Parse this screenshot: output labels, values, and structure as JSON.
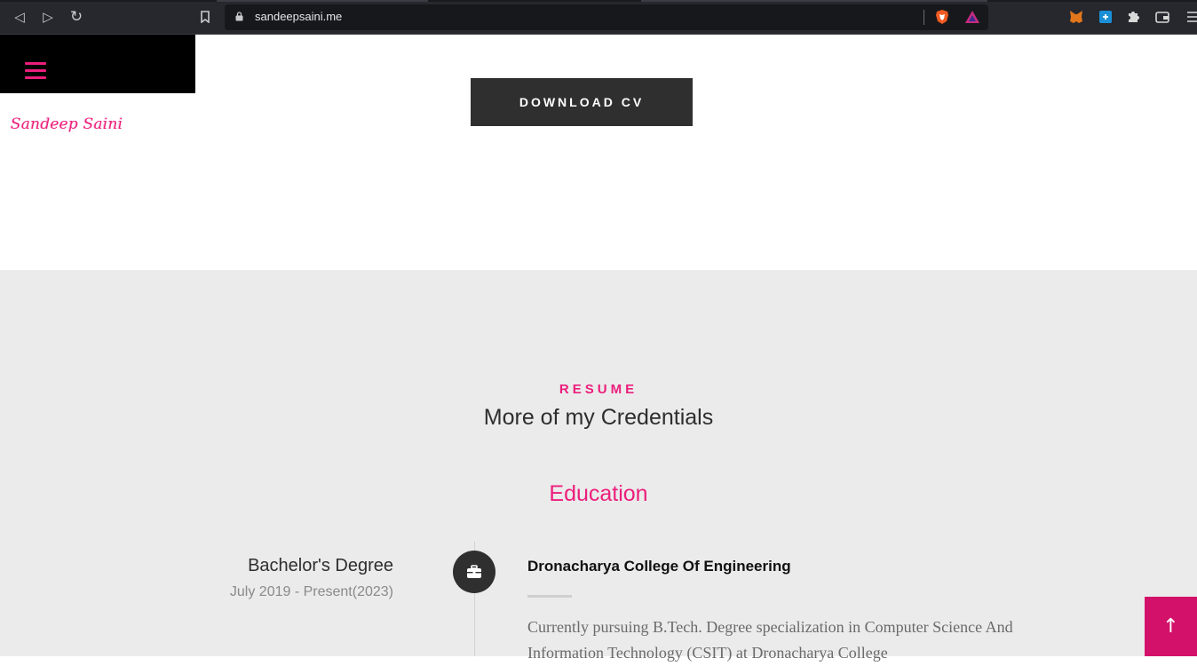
{
  "browser": {
    "url": "sandeepsaini.me",
    "nav": {
      "back": "◁",
      "forward": "▷",
      "reload": "↻"
    }
  },
  "sidebar": {
    "brand": "Sandeep Saini"
  },
  "hero": {
    "download_cv": "DOWNLOAD CV"
  },
  "resume": {
    "eyebrow": "RESUME",
    "title": "More of my Credentials",
    "education_heading": "Education",
    "entry": {
      "degree": "Bachelor's Degree",
      "period": "July 2019 - Present(2023)",
      "institution": "Dronacharya College Of Engineering",
      "description": "Currently pursuing B.Tech. Degree specialization in Computer Science And Information Technology (CSIT) at Dronacharya College"
    }
  },
  "back_to_top": "↑"
}
